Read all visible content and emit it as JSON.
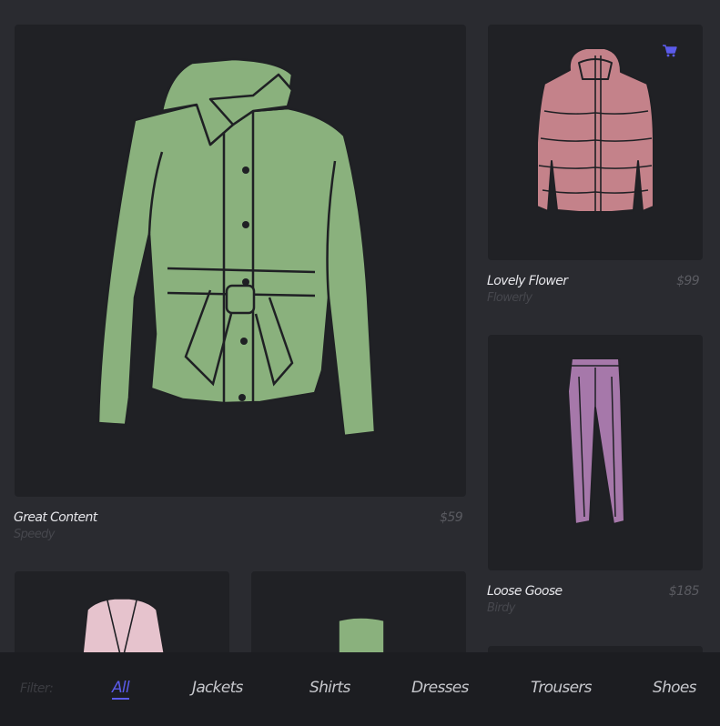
{
  "products": [
    {
      "name": "Great Content",
      "brand": "Speedy",
      "price": "$59",
      "image": "green-belted-jacket"
    },
    {
      "name": "Lovely Flower",
      "brand": "Flowerly",
      "price": "$99",
      "image": "pink-puffer-jacket",
      "cart_icon": "shopping-cart-icon"
    },
    {
      "name": "Loose Goose",
      "brand": "Birdy",
      "price": "$185",
      "image": "purple-trousers"
    },
    {
      "name": "",
      "brand": "",
      "price": "",
      "image": "pink-blazer"
    },
    {
      "name": "",
      "brand": "",
      "price": "",
      "image": "green-tube-top"
    }
  ],
  "filter": {
    "label": "Filter:",
    "items": [
      "All",
      "Jackets",
      "Shirts",
      "Dresses",
      "Trousers",
      "Shoes"
    ],
    "active": "All"
  },
  "colors": {
    "background": "#2a2b30",
    "card": "#202125",
    "accent": "#5b5bea",
    "green_jacket": "#8ab17d",
    "pink_jacket": "#c4828a",
    "purple_trousers": "#a678aa"
  }
}
